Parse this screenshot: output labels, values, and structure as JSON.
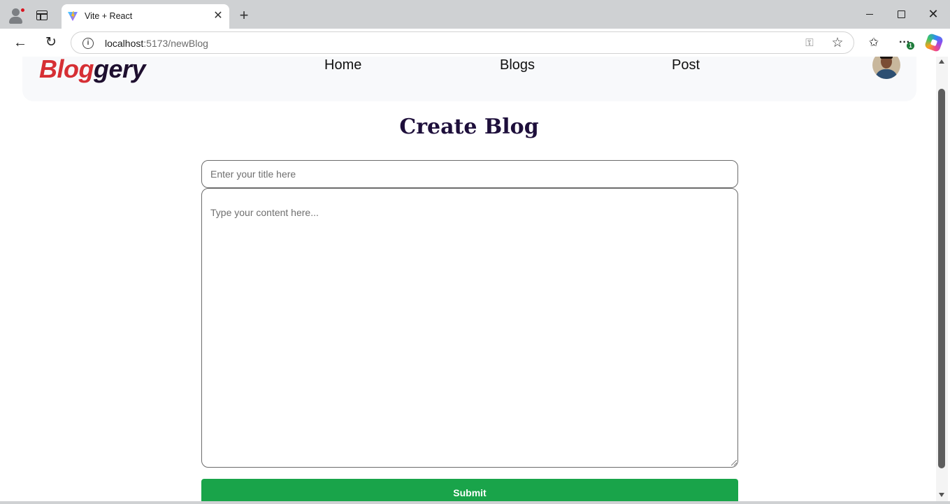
{
  "browser": {
    "tab_title": "Vite + React",
    "url_host": "localhost",
    "url_path": ":5173/newBlog",
    "notification_count": "1"
  },
  "navbar": {
    "logo_part1": "Blog",
    "logo_part2": "gery",
    "links": {
      "home": "Home",
      "blogs": "Blogs",
      "post": "Post"
    }
  },
  "page": {
    "title": "Create Blog",
    "title_placeholder": "Enter your title here",
    "content_placeholder": "Type your content here...",
    "submit_label": "Submit"
  },
  "colors": {
    "logo_red": "#d62f34",
    "logo_dark": "#1e0f2f",
    "heading": "#1e0f3b",
    "submit_green": "#19a44a"
  }
}
